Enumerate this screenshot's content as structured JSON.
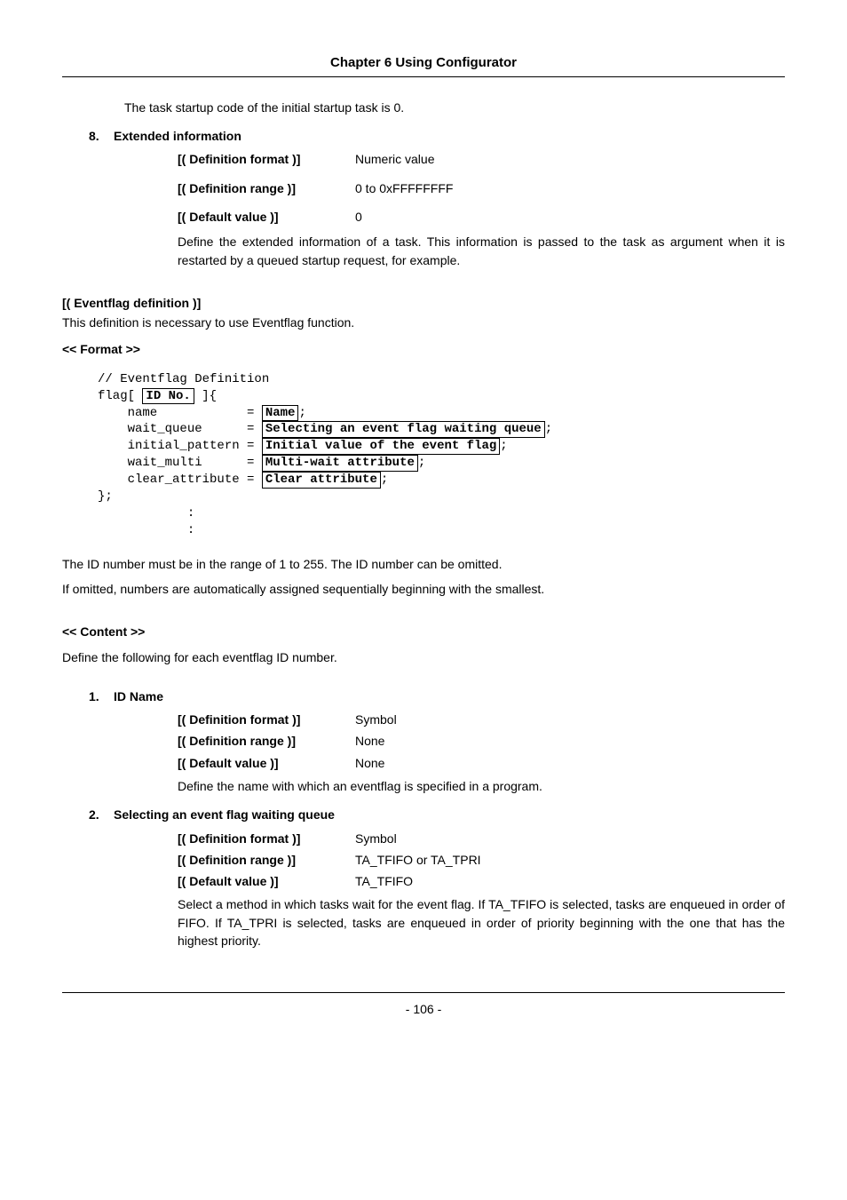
{
  "header": {
    "chapter": "Chapter 6 Using Configurator"
  },
  "intro_line": "The task startup code of the initial startup task is 0.",
  "item8": {
    "num": "8.",
    "title": "Extended information",
    "rows": {
      "fmt_k": "[( Definition format )]",
      "fmt_v": "Numeric value",
      "rng_k": "[( Definition range )]",
      "rng_v": "0 to 0xFFFFFFFF",
      "def_k": "[( Default value )]",
      "def_v": "0"
    },
    "para": "Define the extended information of a task. This information is passed to the task as argument when it is restarted by a queued startup request, for example."
  },
  "eventflag": {
    "title": "[( Eventflag definition )]",
    "desc": "This definition is necessary to use Eventflag function.",
    "format_title": "<< Format >>",
    "code": {
      "l1": "// Eventflag Definition",
      "l2a": "flag[ ",
      "l2b": "ID No.",
      "l2c": " ]{",
      "l3a": "    name            = ",
      "l3b": "Name",
      "l3c": ";",
      "l4a": "    wait_queue      = ",
      "l4b": "Selecting an event flag waiting queue",
      "l4c": ";",
      "l5a": "    initial_pattern = ",
      "l5b": "Initial value of the event flag",
      "l5c": ";",
      "l6a": "    wait_multi      = ",
      "l6b": "Multi-wait attribute",
      "l6c": ";",
      "l7a": "    clear_attribute = ",
      "l7b": "Clear attribute",
      "l7c": ";",
      "l8": "};",
      "l9": "            :",
      "l10": "            :"
    },
    "after1": "The ID number must be in the range of 1 to 255. The ID number can be omitted.",
    "after2": "If omitted, numbers are automatically assigned sequentially beginning with the smallest.",
    "content_title": "<< Content >>",
    "content_body": "Define the following for each eventflag ID number."
  },
  "item1": {
    "num": "1.",
    "title": "ID Name",
    "rows": {
      "fmt_k": "[( Definition format )]",
      "fmt_v": "Symbol",
      "rng_k": "[( Definition range )]",
      "rng_v": "None",
      "def_k": "[( Default value )]",
      "def_v": "None"
    },
    "para": "Define the name with which an eventflag is specified in a program."
  },
  "item2": {
    "num": "2.",
    "title": " Selecting an event flag waiting queue",
    "rows": {
      "fmt_k": "[( Definition format )]",
      "fmt_v": "Symbol",
      "rng_k": "[( Definition range )]",
      "rng_v": "TA_TFIFO or TA_TPRI",
      "def_k": "[( Default value )]",
      "def_v": "TA_TFIFO"
    },
    "para": "Select a method in which tasks wait for the event flag. If TA_TFIFO is selected, tasks are enqueued in order of FIFO. If TA_TPRI is selected, tasks are enqueued in order of priority beginning with the one that has the highest priority."
  },
  "footer": {
    "page": "- 106 -"
  }
}
